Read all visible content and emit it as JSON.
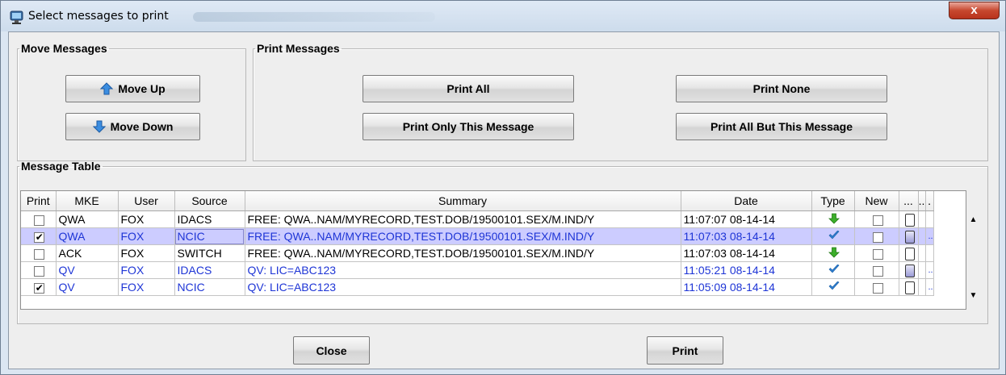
{
  "window": {
    "title": "Select messages to print",
    "close_label": "x"
  },
  "move_group": {
    "legend": "Move Messages",
    "move_up": "Move Up",
    "move_down": "Move Down"
  },
  "print_group": {
    "legend": "Print Messages",
    "print_all": "Print All",
    "print_none": "Print None",
    "print_only": "Print Only This Message",
    "print_all_but": "Print All But This Message"
  },
  "table_group": {
    "legend": "Message Table"
  },
  "table": {
    "headers": [
      "Print",
      "MKE",
      "User",
      "Source",
      "Summary",
      "Date",
      "Type",
      "New",
      "...",
      "..",
      "."
    ],
    "rows": [
      {
        "print": false,
        "mke": "QWA",
        "user": "FOX",
        "source": "IDACS",
        "summary": "FREE: QWA..NAM/MYRECORD,TEST.DOB/19500101.SEX/M.IND/Y",
        "date": "11:07:07 08-14-14",
        "type": "down-arrow",
        "new": false,
        "doc": "empty",
        "dots": "",
        "color": "black",
        "selected": false
      },
      {
        "print": true,
        "mke": "QWA",
        "user": "FOX",
        "source": "NCIC",
        "summary": "FREE: QWA..NAM/MYRECORD,TEST.DOB/19500101.SEX/M.IND/Y",
        "date": "11:07:03 08-14-14",
        "type": "check",
        "new": false,
        "doc": "filled",
        "dots": "..",
        "color": "blue",
        "selected": true
      },
      {
        "print": false,
        "mke": "ACK",
        "user": "FOX",
        "source": "SWITCH",
        "summary": "FREE: QWA..NAM/MYRECORD,TEST.DOB/19500101.SEX/M.IND/Y",
        "date": "11:07:03 08-14-14",
        "type": "down-arrow",
        "new": false,
        "doc": "empty",
        "dots": "",
        "color": "black",
        "selected": false
      },
      {
        "print": false,
        "mke": "QV",
        "user": "FOX",
        "source": "IDACS",
        "summary": "QV: LIC=ABC123",
        "date": "11:05:21 08-14-14",
        "type": "check",
        "new": false,
        "doc": "filled",
        "dots": "..",
        "color": "blue",
        "selected": false
      },
      {
        "print": true,
        "mke": "QV",
        "user": "FOX",
        "source": "NCIC",
        "summary": "QV: LIC=ABC123",
        "date": "11:05:09 08-14-14",
        "type": "check",
        "new": false,
        "doc": "empty",
        "dots": "..",
        "color": "blue",
        "selected": false
      }
    ]
  },
  "bottom": {
    "close": "Close",
    "print": "Print"
  },
  "colors": {
    "blue_text": "#1e35d6",
    "selected_row": "#ccccff",
    "green_arrow": "#3cae2a",
    "blue_check": "#2f7fd0"
  }
}
